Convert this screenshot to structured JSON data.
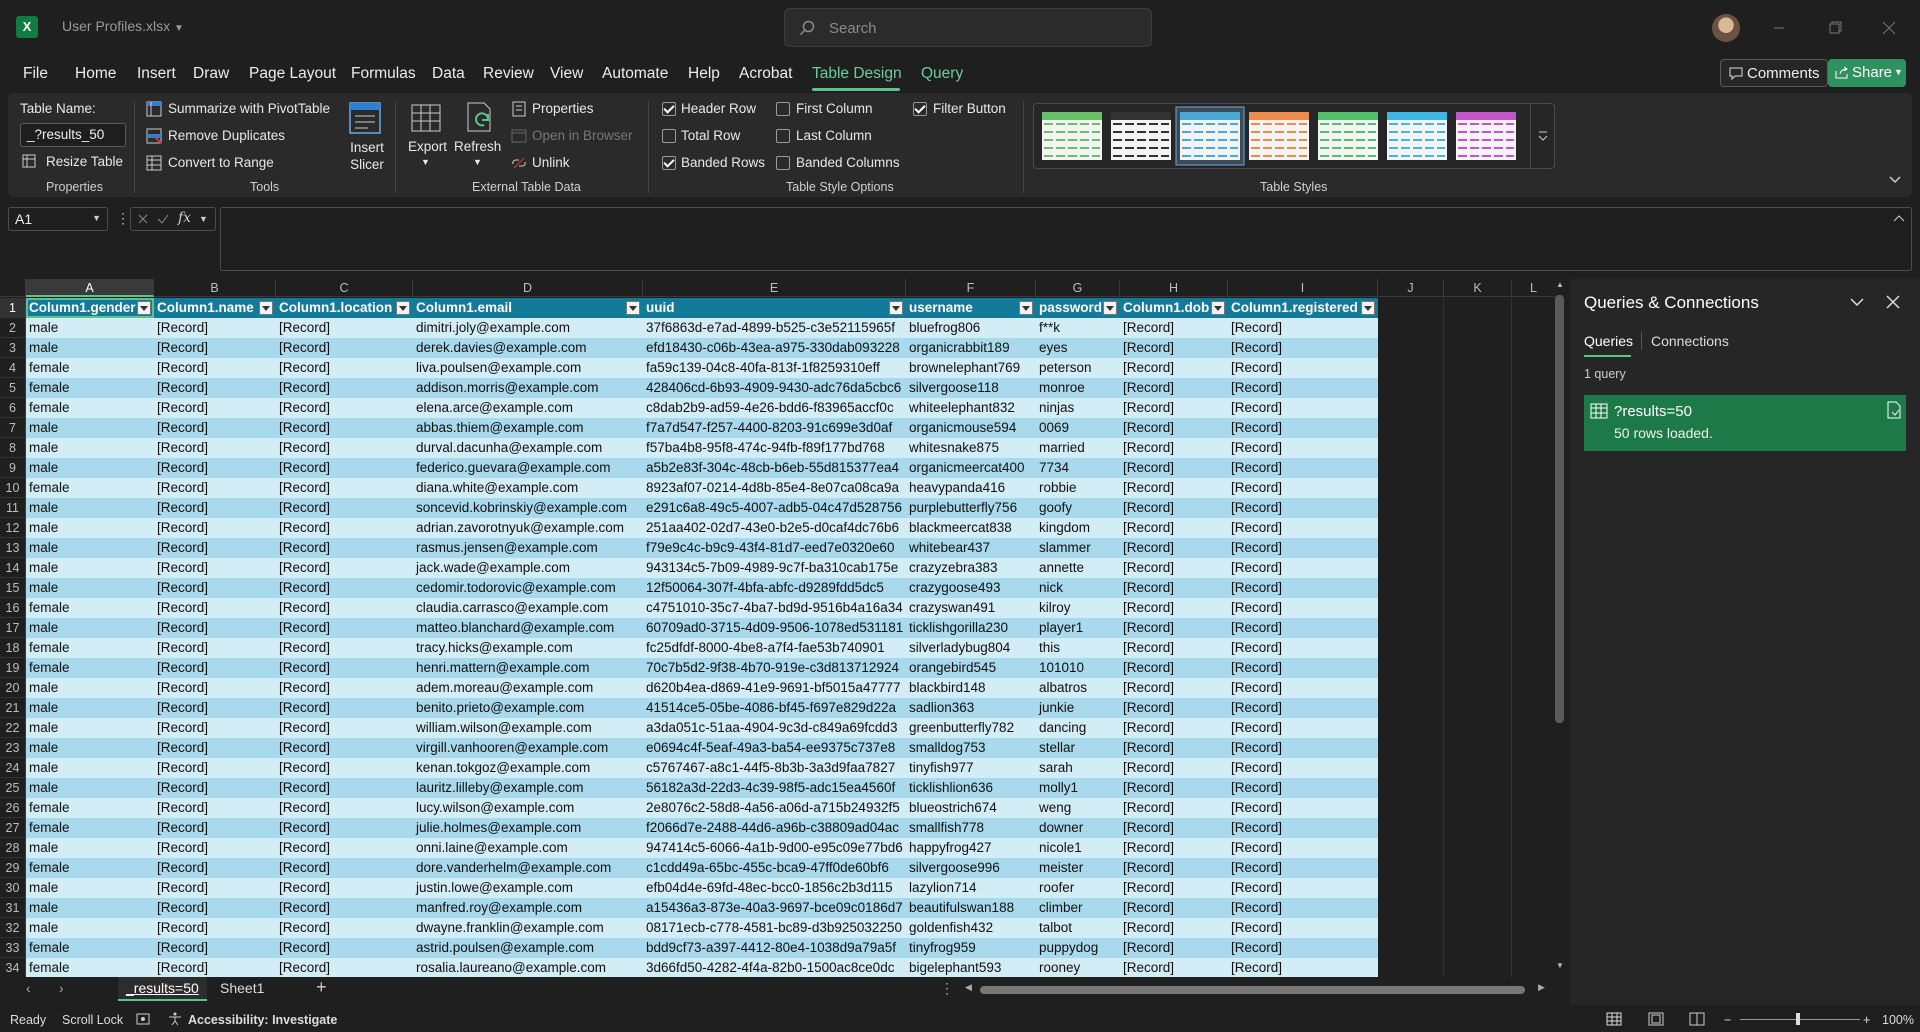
{
  "app": {
    "file_name": "User Profiles.xlsx",
    "search_placeholder": "Search"
  },
  "ribbon_tabs": [
    "File",
    "Home",
    "Insert",
    "Draw",
    "Page Layout",
    "Formulas",
    "Data",
    "Review",
    "View",
    "Help",
    "Automate",
    "Acrobat",
    "Table Design",
    "Query"
  ],
  "active_tab": "Table Design",
  "header_buttons": {
    "comments": "Comments",
    "share": "Share"
  },
  "ribbon": {
    "properties": {
      "table_name_label": "Table Name:",
      "table_name_value": "_?results_50",
      "resize_table": "Resize Table",
      "group_label": "Properties"
    },
    "tools": {
      "summarize": "Summarize with PivotTable",
      "remove_duplicates": "Remove Duplicates",
      "convert_to_range": "Convert to Range",
      "insert_slicer": "Insert Slicer",
      "group_label": "Tools"
    },
    "external": {
      "export": "Export",
      "refresh": "Refresh",
      "properties": "Properties",
      "open_in_browser": "Open in Browser",
      "unlink": "Unlink",
      "group_label": "External Table Data"
    },
    "style_options": {
      "header_row": {
        "label": "Header Row",
        "checked": true
      },
      "total_row": {
        "label": "Total Row",
        "checked": false
      },
      "banded_rows": {
        "label": "Banded Rows",
        "checked": true
      },
      "first_column": {
        "label": "First Column",
        "checked": false
      },
      "last_column": {
        "label": "Last Column",
        "checked": false
      },
      "banded_columns": {
        "label": "Banded Columns",
        "checked": false
      },
      "filter_button": {
        "label": "Filter Button",
        "checked": true
      },
      "group_label": "Table Style Options"
    },
    "table_styles": {
      "group_label": "Table Styles",
      "swatch_colors": [
        "#6abf69",
        "#333333",
        "#4aa8d8",
        "#f08a4b",
        "#4fbf6a",
        "#3db8e6",
        "#c455c9"
      ],
      "selected_index": 2
    }
  },
  "formula_bar": {
    "name_box": "A1",
    "fx": "fx",
    "content": ""
  },
  "columns": [
    {
      "letter": "A",
      "header": "Column1.gender",
      "filter": true
    },
    {
      "letter": "B",
      "header": "Column1.name",
      "filter": true
    },
    {
      "letter": "C",
      "header": "Column1.location",
      "filter": true
    },
    {
      "letter": "D",
      "header": "Column1.email",
      "filter": true
    },
    {
      "letter": "E",
      "header": "uuid",
      "filter": true
    },
    {
      "letter": "F",
      "header": "username",
      "filter": true
    },
    {
      "letter": "G",
      "header": "password",
      "filter": true
    },
    {
      "letter": "H",
      "header": "Column1.dob",
      "filter": true
    },
    {
      "letter": "I",
      "header": "Column1.registered",
      "filter": true
    },
    {
      "letter": "J",
      "header": "",
      "filter": false
    },
    {
      "letter": "K",
      "header": "",
      "filter": false
    },
    {
      "letter": "L",
      "header": "",
      "filter": false
    }
  ],
  "header_row_number": "1",
  "rows": [
    {
      "n": "2",
      "c": [
        "male",
        "[Record]",
        "[Record]",
        "dimitri.joly@example.com",
        "37f6863d-e7ad-4899-b525-c3e52115965f",
        "bluefrog806",
        "f**k",
        "[Record]",
        "[Record]"
      ]
    },
    {
      "n": "3",
      "c": [
        "male",
        "[Record]",
        "[Record]",
        "derek.davies@example.com",
        "efd18430-c06b-43ea-a975-330dab093228",
        "organicrabbit189",
        "eyes",
        "[Record]",
        "[Record]"
      ]
    },
    {
      "n": "4",
      "c": [
        "female",
        "[Record]",
        "[Record]",
        "liva.poulsen@example.com",
        "fa59c139-04c8-40fa-813f-1f8259310eff",
        "brownelephant769",
        "peterson",
        "[Record]",
        "[Record]"
      ]
    },
    {
      "n": "5",
      "c": [
        "female",
        "[Record]",
        "[Record]",
        "addison.morris@example.com",
        "428406cd-6b93-4909-9430-adc76da5cbc6",
        "silvergoose118",
        "monroe",
        "[Record]",
        "[Record]"
      ]
    },
    {
      "n": "6",
      "c": [
        "female",
        "[Record]",
        "[Record]",
        "elena.arce@example.com",
        "c8dab2b9-ad59-4e26-bdd6-f83965accf0c",
        "whiteelephant832",
        "ninjas",
        "[Record]",
        "[Record]"
      ]
    },
    {
      "n": "7",
      "c": [
        "male",
        "[Record]",
        "[Record]",
        "abbas.thiem@example.com",
        "f7a7d547-f257-4400-8203-91c699e3d0af",
        "organicmouse594",
        "0069",
        "[Record]",
        "[Record]"
      ]
    },
    {
      "n": "8",
      "c": [
        "male",
        "[Record]",
        "[Record]",
        "durval.dacunha@example.com",
        "f57ba4b8-95f8-474c-94fb-f89f177bd768",
        "whitesnake875",
        "married",
        "[Record]",
        "[Record]"
      ]
    },
    {
      "n": "9",
      "c": [
        "male",
        "[Record]",
        "[Record]",
        "federico.guevara@example.com",
        "a5b2e83f-304c-48cb-b6eb-55d815377ea4",
        "organicmeercat400",
        "7734",
        "[Record]",
        "[Record]"
      ]
    },
    {
      "n": "10",
      "c": [
        "female",
        "[Record]",
        "[Record]",
        "diana.white@example.com",
        "8923af07-0214-4d8b-85e4-8e07ca08ca9a",
        "heavypanda416",
        "robbie",
        "[Record]",
        "[Record]"
      ]
    },
    {
      "n": "11",
      "c": [
        "male",
        "[Record]",
        "[Record]",
        "soncevid.kobrinskiy@example.com",
        "e291c6a8-49c5-4007-adb5-04c47d528756",
        "purplebutterfly756",
        "goofy",
        "[Record]",
        "[Record]"
      ]
    },
    {
      "n": "12",
      "c": [
        "male",
        "[Record]",
        "[Record]",
        "adrian.zavorotnyuk@example.com",
        "251aa402-02d7-43e0-b2e5-d0caf4dc76b6",
        "blackmeercat838",
        "kingdom",
        "[Record]",
        "[Record]"
      ]
    },
    {
      "n": "13",
      "c": [
        "male",
        "[Record]",
        "[Record]",
        "rasmus.jensen@example.com",
        "f79e9c4c-b9c9-43f4-81d7-eed7e0320e60",
        "whitebear437",
        "slammer",
        "[Record]",
        "[Record]"
      ]
    },
    {
      "n": "14",
      "c": [
        "male",
        "[Record]",
        "[Record]",
        "jack.wade@example.com",
        "943134c5-7b09-4989-9c7f-ba310cab175e",
        "crazyzebra383",
        "annette",
        "[Record]",
        "[Record]"
      ]
    },
    {
      "n": "15",
      "c": [
        "male",
        "[Record]",
        "[Record]",
        "cedomir.todorovic@example.com",
        "12f50064-307f-4bfa-abfc-d9289fdd5dc5",
        "crazygoose493",
        "nick",
        "[Record]",
        "[Record]"
      ]
    },
    {
      "n": "16",
      "c": [
        "female",
        "[Record]",
        "[Record]",
        "claudia.carrasco@example.com",
        "c4751010-35c7-4ba7-bd9d-9516b4a16a34",
        "crazyswan491",
        "kilroy",
        "[Record]",
        "[Record]"
      ]
    },
    {
      "n": "17",
      "c": [
        "male",
        "[Record]",
        "[Record]",
        "matteo.blanchard@example.com",
        "60709ad0-3715-4d09-9506-1078ed531181",
        "ticklishgorilla230",
        "player1",
        "[Record]",
        "[Record]"
      ]
    },
    {
      "n": "18",
      "c": [
        "female",
        "[Record]",
        "[Record]",
        "tracy.hicks@example.com",
        "fc25dfdf-8000-4be8-a7f4-fae53b740901",
        "silverladybug804",
        "this",
        "[Record]",
        "[Record]"
      ]
    },
    {
      "n": "19",
      "c": [
        "female",
        "[Record]",
        "[Record]",
        "henri.mattern@example.com",
        "70c7b5d2-9f38-4b70-919e-c3d813712924",
        "orangebird545",
        "101010",
        "[Record]",
        "[Record]"
      ]
    },
    {
      "n": "20",
      "c": [
        "male",
        "[Record]",
        "[Record]",
        "adem.moreau@example.com",
        "d620b4ea-d869-41e9-9691-bf5015a47777",
        "blackbird148",
        "albatros",
        "[Record]",
        "[Record]"
      ]
    },
    {
      "n": "21",
      "c": [
        "male",
        "[Record]",
        "[Record]",
        "benito.prieto@example.com",
        "41514ce5-05be-4086-bf45-f697e829d22a",
        "sadlion363",
        "junkie",
        "[Record]",
        "[Record]"
      ]
    },
    {
      "n": "22",
      "c": [
        "male",
        "[Record]",
        "[Record]",
        "william.wilson@example.com",
        "a3da051c-51aa-4904-9c3d-c849a69fcdd3",
        "greenbutterfly782",
        "dancing",
        "[Record]",
        "[Record]"
      ]
    },
    {
      "n": "23",
      "c": [
        "male",
        "[Record]",
        "[Record]",
        "virgill.vanhooren@example.com",
        "e0694c4f-5eaf-49a3-ba54-ee9375c737e8",
        "smalldog753",
        "stellar",
        "[Record]",
        "[Record]"
      ]
    },
    {
      "n": "24",
      "c": [
        "male",
        "[Record]",
        "[Record]",
        "kenan.tokgoz@example.com",
        "c5767467-a8c1-44f5-8b3b-3a3d9faa7827",
        "tinyfish977",
        "sarah",
        "[Record]",
        "[Record]"
      ]
    },
    {
      "n": "25",
      "c": [
        "male",
        "[Record]",
        "[Record]",
        "lauritz.lilleby@example.com",
        "56182a3d-22d3-4c39-98f5-adc15ea4560f",
        "ticklishlion636",
        "molly1",
        "[Record]",
        "[Record]"
      ]
    },
    {
      "n": "26",
      "c": [
        "female",
        "[Record]",
        "[Record]",
        "lucy.wilson@example.com",
        "2e8076c2-58d8-4a56-a06d-a715b24932f5",
        "blueostrich674",
        "weng",
        "[Record]",
        "[Record]"
      ]
    },
    {
      "n": "27",
      "c": [
        "female",
        "[Record]",
        "[Record]",
        "julie.holmes@example.com",
        "f2066d7e-2488-44d6-a96b-c38809ad04ac",
        "smallfish778",
        "downer",
        "[Record]",
        "[Record]"
      ]
    },
    {
      "n": "28",
      "c": [
        "male",
        "[Record]",
        "[Record]",
        "onni.laine@example.com",
        "947414c5-6066-4a1b-9d00-e95c09e77bd6",
        "happyfrog427",
        "nicole1",
        "[Record]",
        "[Record]"
      ]
    },
    {
      "n": "29",
      "c": [
        "female",
        "[Record]",
        "[Record]",
        "dore.vanderhelm@example.com",
        "c1cdd49a-65bc-455c-bca9-47ff0de60bf6",
        "silvergoose996",
        "meister",
        "[Record]",
        "[Record]"
      ]
    },
    {
      "n": "30",
      "c": [
        "male",
        "[Record]",
        "[Record]",
        "justin.lowe@example.com",
        "efb04d4e-69fd-48ec-bcc0-1856c2b3d115",
        "lazylion714",
        "roofer",
        "[Record]",
        "[Record]"
      ]
    },
    {
      "n": "31",
      "c": [
        "male",
        "[Record]",
        "[Record]",
        "manfred.roy@example.com",
        "a15436a3-873e-40a3-9697-bce09c0186d7",
        "beautifulswan188",
        "climber",
        "[Record]",
        "[Record]"
      ]
    },
    {
      "n": "32",
      "c": [
        "male",
        "[Record]",
        "[Record]",
        "dwayne.franklin@example.com",
        "08171ecb-c778-4581-bc89-d3b925032250",
        "goldenfish432",
        "talbot",
        "[Record]",
        "[Record]"
      ]
    },
    {
      "n": "33",
      "c": [
        "female",
        "[Record]",
        "[Record]",
        "astrid.poulsen@example.com",
        "bdd9cf73-a397-4412-80e4-1038d9a79a5f",
        "tinyfrog959",
        "puppydog",
        "[Record]",
        "[Record]"
      ]
    },
    {
      "n": "34",
      "c": [
        "female",
        "[Record]",
        "[Record]",
        "rosalia.laureano@example.com",
        "3d66fd50-4282-4f4a-82b0-1500ac8ce0dc",
        "bigelephant593",
        "rooney",
        "[Record]",
        "[Record]"
      ]
    }
  ],
  "table_colors": {
    "header": "#147a99",
    "band_light": "#d3edf6",
    "band_dark": "#a9d9ec",
    "accent": "#5ec28f"
  },
  "sheet_tabs": [
    "_results=50",
    "Sheet1"
  ],
  "active_sheet": "_results=50",
  "status": {
    "ready": "Ready",
    "scroll_lock": "Scroll Lock",
    "accessibility": "Accessibility: Investigate",
    "zoom": "100%"
  },
  "queries_pane": {
    "title": "Queries & Connections",
    "tabs": [
      "Queries",
      "Connections"
    ],
    "count": "1 query",
    "query_name": "?results=50",
    "query_status": "50 rows loaded."
  }
}
